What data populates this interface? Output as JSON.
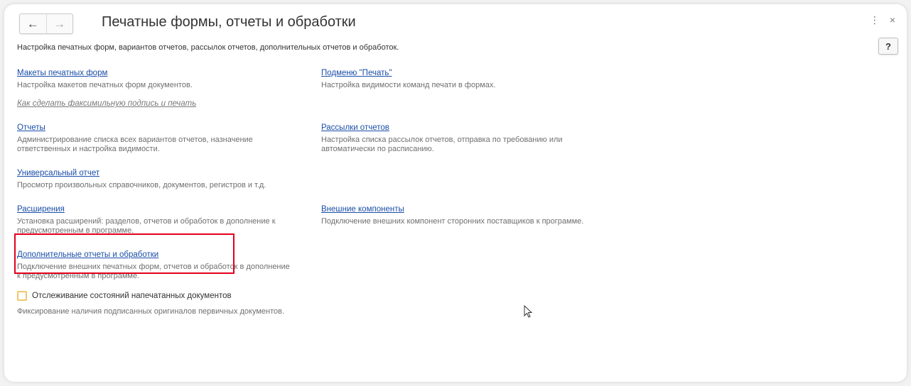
{
  "header": {
    "back_icon": "←",
    "forward_icon": "→",
    "title": "Печатные формы, отчеты и обработки",
    "more_icon": "⋮",
    "close_icon": "×",
    "help_label": "?"
  },
  "description": "Настройка печатных форм, вариантов отчетов, рассылок отчетов, дополнительных отчетов и обработок.",
  "sections": {
    "print_templates": {
      "link": "Макеты печатных форм",
      "note": "Настройка макетов печатных форм документов."
    },
    "print_submenu": {
      "link": "Подменю \"Печать\"",
      "note": "Настройка видимости команд печати в формах."
    },
    "facsimile_link": "Как сделать факсимильную подпись и печать",
    "reports": {
      "link": "Отчеты",
      "note": "Администрирование списка всех вариантов отчетов, назначение ответственных и настройка видимости."
    },
    "report_mailings": {
      "link": "Рассылки отчетов",
      "note": "Настройка списка рассылок отчетов, отправка по требованию или автоматически по расписанию."
    },
    "universal_report": {
      "link": "Универсальный отчет",
      "note": "Просмотр произвольных справочников, документов, регистров и т.д."
    },
    "extensions": {
      "link": "Расширения",
      "note": "Установка расширений: разделов, отчетов и обработок в дополнение к предусмотренным в программе."
    },
    "external_components": {
      "link": "Внешние компоненты",
      "note": "Подключение внешних компонент сторонних поставщиков к программе."
    },
    "additional_reports": {
      "link": "Дополнительные отчеты и обработки",
      "note": "Подключение внешних печатных форм, отчетов и обработок в дополнение к предусмотренным в программе."
    },
    "tracking": {
      "label": "Отслеживание состояний напечатанных документов",
      "checked": false,
      "note": "Фиксирование наличия подписанных оригиналов первичных документов."
    }
  },
  "colors": {
    "link": "#1a4ea8",
    "highlight": "#e3001b",
    "checkbox_border": "#ecc86a"
  }
}
